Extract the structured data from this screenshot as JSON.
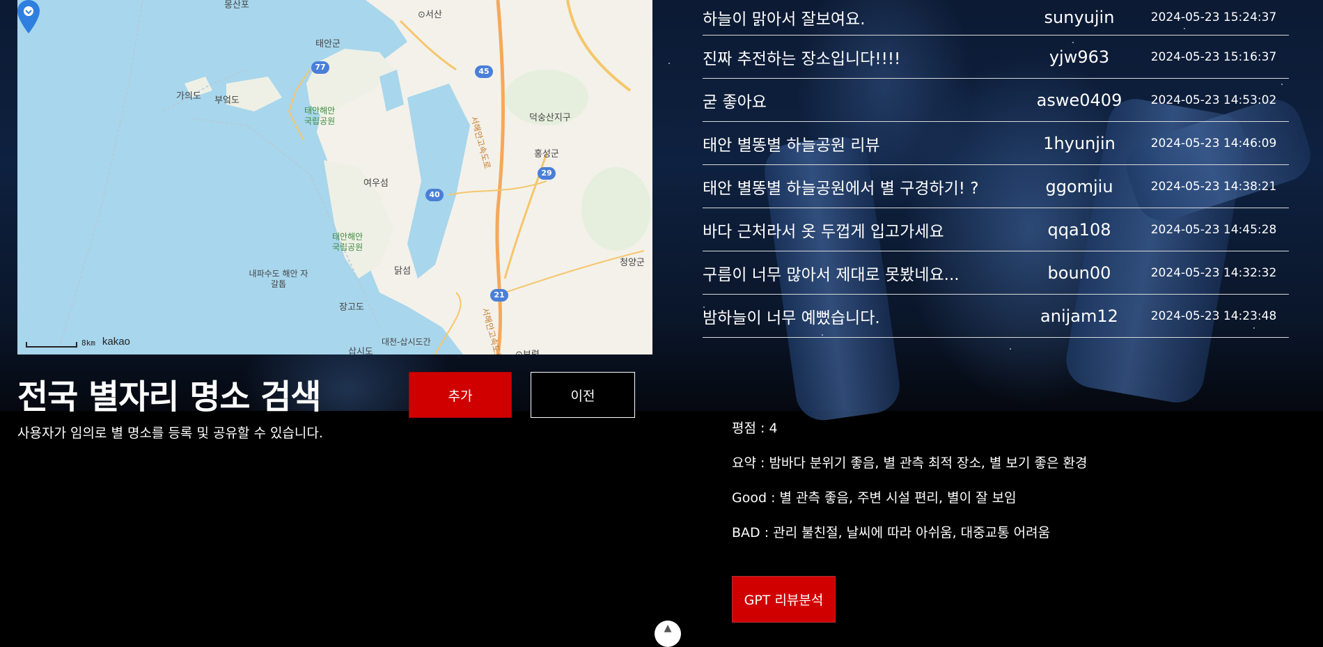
{
  "map": {
    "labels": {
      "top_clipped": "몽산포",
      "seosan": "⊙서산",
      "taean": "태안군",
      "gauido": "가의도",
      "bueokdo": "부엌도",
      "taean_park_top": "태안해안 국립공원",
      "deoksan": "덕숭산지구",
      "hongseong": "홍성군",
      "yeouseom": "여우섬",
      "taean_park": "태안해안 국립공원",
      "daksum": "닭섬",
      "naepasudo": "내파수도 해안 자갈톱",
      "janggodo": "장고도",
      "cheongyang": "청양군",
      "sapsido": "삽시도",
      "daecheon": "대천-삽시도간",
      "boryeong": "⊙보령",
      "expressway1": "서해안고속도로",
      "expressway2": "서해안고속도로"
    },
    "highways": [
      "77",
      "45",
      "29",
      "40",
      "21"
    ],
    "scale": "8km",
    "brand": "kakao"
  },
  "header": {
    "title": "전국 별자리 명소 검색",
    "subtitle": "사용자가 임의로 별 명소를 등록 및 공유할 수 있습니다.",
    "add_label": "추가",
    "prev_label": "이전"
  },
  "reviews": [
    {
      "title": "하늘이 맑아서 잘보여요.",
      "user": "sunyujin",
      "date": "2024-05-23 15:24:37"
    },
    {
      "title": "진짜 추전하는 장소입니다!!!!",
      "user": "yjw963",
      "date": "2024-05-23 15:16:37"
    },
    {
      "title": "굳 좋아요",
      "user": "aswe0409",
      "date": "2024-05-23 14:53:02"
    },
    {
      "title": "태안 별똥별 하늘공원 리뷰",
      "user": "1hyunjin",
      "date": "2024-05-23 14:46:09"
    },
    {
      "title": "태안 별똥별 하늘공원에서 별 구경하기! ?",
      "user": "ggomjiu",
      "date": "2024-05-23 14:38:21"
    },
    {
      "title": "바다 근처라서 옷 두껍게 입고가세요",
      "user": "qqa108",
      "date": "2024-05-23 14:45:28"
    },
    {
      "title": "구름이 너무 많아서 제대로 못봤네요...",
      "user": "boun00",
      "date": "2024-05-23 14:32:32"
    },
    {
      "title": "밤하늘이 너무 예뻤습니다.",
      "user": "anijam12",
      "date": "2024-05-23 14:23:48"
    }
  ],
  "analysis": {
    "rating": "평점 : 4",
    "summary": "요약 : 밤바다 분위기 좋음, 별 관측 최적 장소, 별 보기 좋은 환경",
    "good": "Good : 별 관측 좋음, 주변 시설 편리, 별이 잘 보임",
    "bad": "BAD : 관리 불친절, 날씨에 따라 아쉬움, 대중교통 어려움",
    "gpt_button": "GPT 리뷰분석"
  },
  "scroll_top_icon": "arrow-up-icon",
  "colors": {
    "accent_red": "#d10000",
    "background": "#000000"
  }
}
